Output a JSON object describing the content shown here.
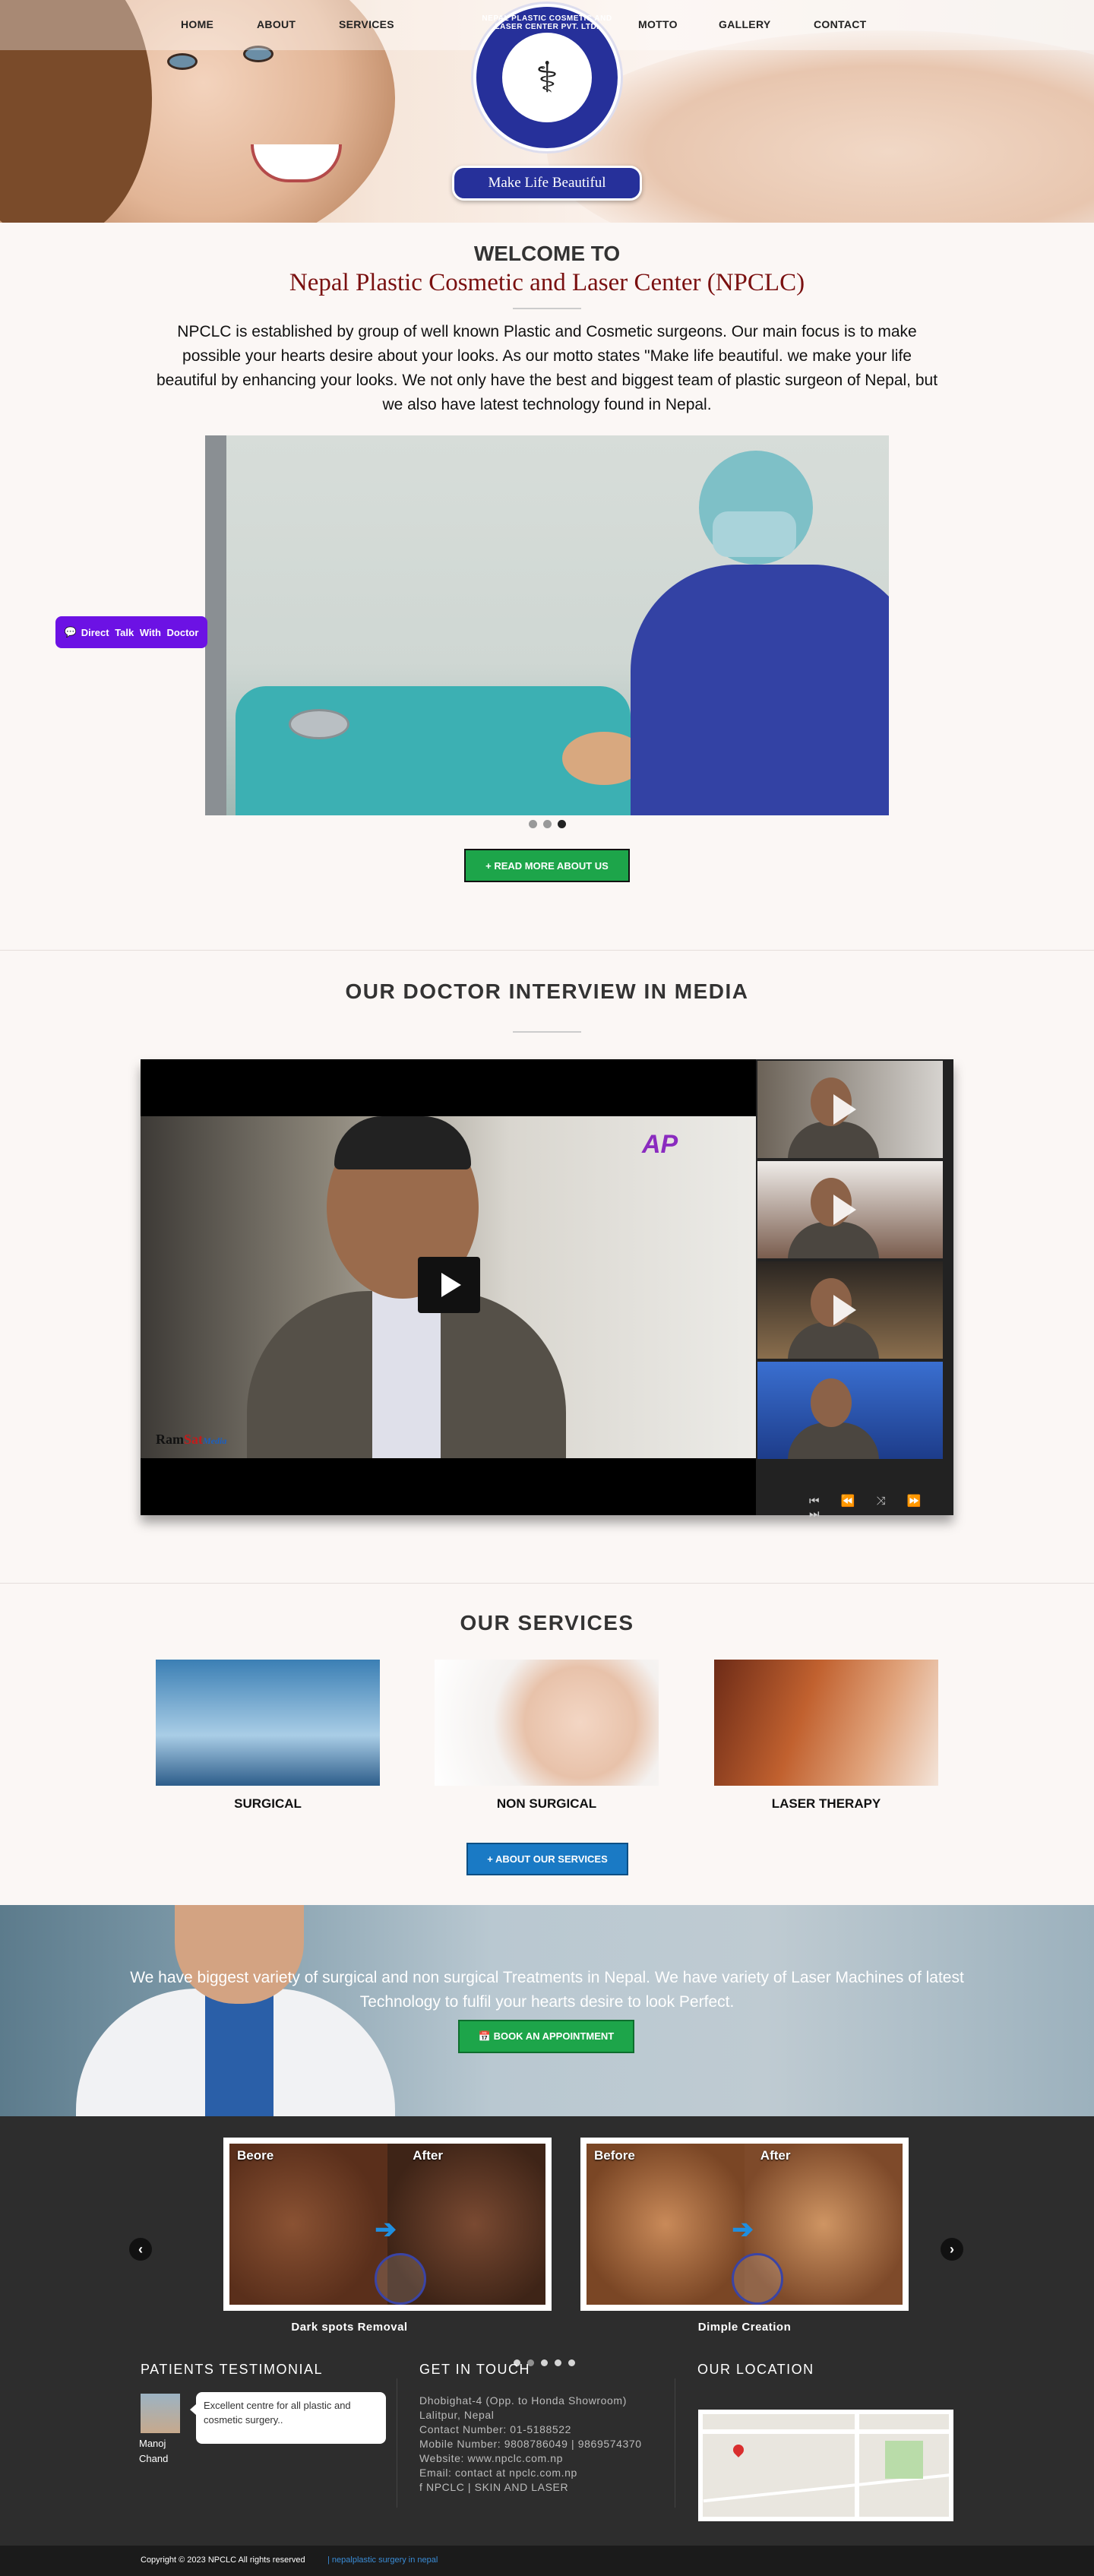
{
  "nav": {
    "home": "HOME",
    "about": "ABOUT",
    "services": "SERVICES",
    "motto": "MOTTO",
    "gallery": "GALLERY",
    "contact": "CONTACT"
  },
  "logo": {
    "ring_text": "NEPAL PLASTIC COSMETIC AND LASER CENTER PVT. LTD.",
    "emblem": "caduceus-icon"
  },
  "motto_badge": "Make Life Beautiful",
  "welcome": {
    "heading": "WELCOME TO",
    "subheading": "Nepal Plastic Cosmetic and Laser Center (NPCLC)",
    "body": "NPCLC is established by group of well known Plastic and Cosmetic surgeons. Our main focus is to make possible your hearts desire about your looks. As our motto states \"Make life beautiful. we make your life beautiful by enhancing your looks. We not only have the best and biggest team of plastic surgeon of Nepal, but we also have latest technology found in Nepal."
  },
  "direct_talk": "Direct Talk With Doctor",
  "slider": {
    "count": 3,
    "active": 3
  },
  "read_more": "+ READ MORE ABOUT US",
  "media": {
    "title": "OUR DOCTOR INTERVIEW IN MEDIA",
    "brand_badge": "AP",
    "ram_brand": {
      "a": "Ram",
      "b": "Sat",
      "c": "Media"
    },
    "controls": "⏮ ⏪ ⤨ ⏩ ⏭"
  },
  "services": {
    "title": "OUR SERVICES",
    "items": [
      {
        "label": "SURGICAL"
      },
      {
        "label": "NON SURGICAL"
      },
      {
        "label": "LASER THERAPY"
      }
    ],
    "button": "+ ABOUT OUR SERVICES"
  },
  "band": {
    "text": "We have biggest variety of surgical and non surgical Treatments in Nepal. We have variety of Laser Machines of latest Technology to fulfil your hearts desire to look Perfect.",
    "button": "📅 BOOK AN APPOINTMENT"
  },
  "gallery": {
    "items": [
      {
        "before": "Beore",
        "after": "After",
        "caption": "Dark spots Removal"
      },
      {
        "before": "Before",
        "after": "After",
        "caption": "Dimple Creation"
      }
    ],
    "prev": "‹",
    "next": "›"
  },
  "footer": {
    "testimonial_title": "PATIENTS TESTIMONIAL",
    "testimonial_text": "Excellent centre for all plastic and cosmetic surgery..",
    "patient_name": "Manoj Chand",
    "contact_title": "GET IN TOUCH",
    "contact_lines": [
      "Dhobighat-4 (Opp. to Honda Showroom)",
      "Lalitpur, Nepal",
      "Contact Number: 01-5188522",
      "Mobile Number: 9808786049 | 9869574370",
      "Website: www.npclc.com.np",
      "Email: contact at npclc.com.np",
      "f NPCLC | SKIN AND LASER"
    ],
    "location_title": "OUR LOCATION",
    "copyright": "Copyright © 2023 NPCLC All rights reserved",
    "link": "| nepalplastic surgery in nepal"
  },
  "colors": {
    "brand_blue": "#26309a",
    "green": "#1da54a",
    "purple": "#6c12e4",
    "service_blue": "#1a7ac5",
    "maroon": "#7a1010"
  }
}
